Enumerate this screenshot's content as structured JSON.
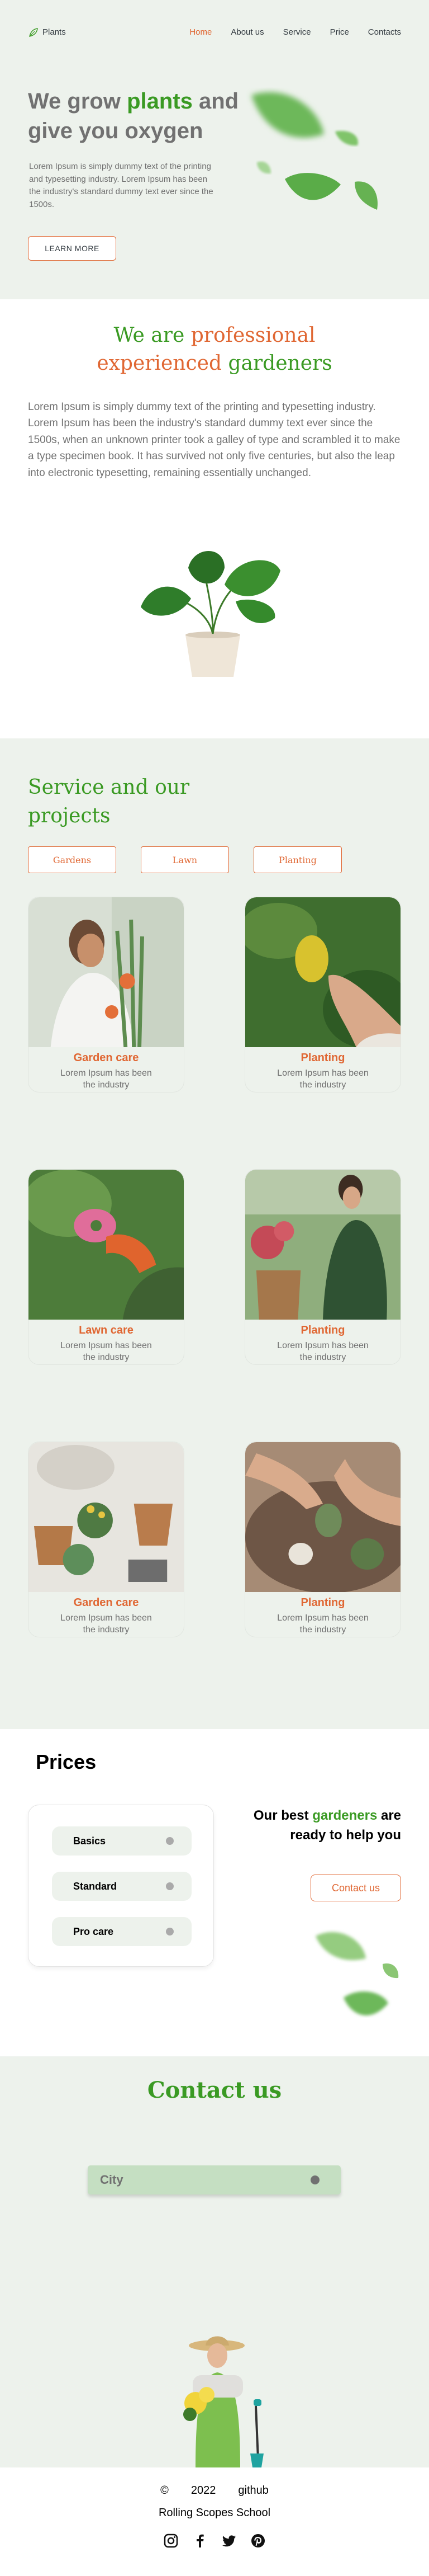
{
  "header": {
    "logo": "Plants",
    "menu": [
      "Home",
      "About us",
      "Service",
      "Price",
      "Contacts"
    ],
    "active": "Home"
  },
  "hero": {
    "title_pre": "We grow ",
    "title_accent": "plants",
    "title_post": " and give you oxygen",
    "text": "Lorem Ipsum is simply dummy text of the printing and typesetting industry. Lorem Ipsum has been the industry's standard dummy text ever since the 1500s.",
    "button": "LEARN MORE"
  },
  "about": {
    "title_part1": "We are ",
    "title_part2": "professional",
    "title_part3": "experienced",
    "title_part4": " gardeners",
    "text": "Lorem Ipsum is simply dummy text of the printing and typesetting industry. Lorem Ipsum has been the industry's standard dummy text ever since the 1500s, when an unknown printer took a galley of type and scrambled it to make a type specimen book. It has survived not only five centuries, but also the leap into electronic typesetting, remaining essentially unchanged."
  },
  "services": {
    "title": "Service and our projects",
    "filters": [
      "Gardens",
      "Lawn",
      "Planting"
    ],
    "cards": [
      {
        "title": "Garden care",
        "text": "Lorem Ipsum has been the industry"
      },
      {
        "title": "Planting",
        "text": "Lorem Ipsum has been the industry"
      },
      {
        "title": "Lawn care",
        "text": "Lorem Ipsum has been the industry"
      },
      {
        "title": "Planting",
        "text": "Lorem Ipsum has been the industry"
      },
      {
        "title": "Garden care",
        "text": "Lorem Ipsum has been the industry"
      },
      {
        "title": "Planting",
        "text": "Lorem Ipsum has been the industry"
      }
    ]
  },
  "prices": {
    "title": "Prices",
    "plans": [
      "Basics",
      "Standard",
      "Pro care"
    ],
    "help_pre": "Our best ",
    "help_accent": "gardeners",
    "help_post": " are ready to help you",
    "button": "Contact us"
  },
  "contact": {
    "title": "Contact us",
    "select_value": "City"
  },
  "footer": {
    "copyright": "©",
    "year": "2022",
    "github": "github",
    "school": "Rolling Scopes School",
    "socials": [
      "instagram-icon",
      "facebook-icon",
      "twitter-icon",
      "pinterest-icon"
    ]
  },
  "colors": {
    "accent_green": "#3a9a23",
    "accent_orange": "#e06733",
    "background_mint": "#edf2ec"
  }
}
